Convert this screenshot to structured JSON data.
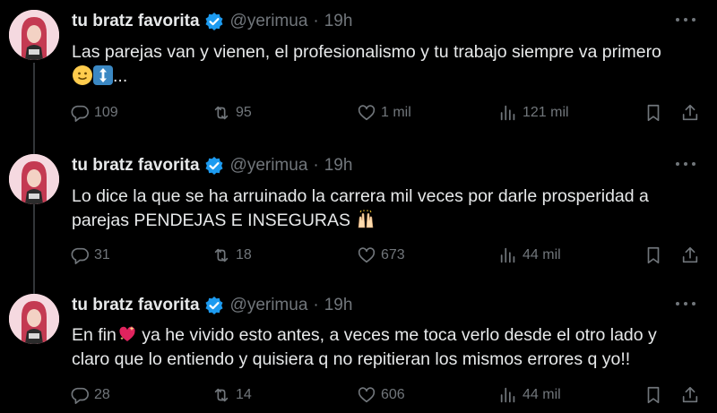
{
  "author": {
    "name": "tu bratz favorita",
    "handle": "@yerimua",
    "separator": "·",
    "time": "19h"
  },
  "icons": {
    "verified": "verified-badge-icon",
    "more": "more-options-icon",
    "reply": "reply-icon",
    "retweet": "retweet-icon",
    "like": "like-icon",
    "views": "views-icon",
    "bookmark": "bookmark-icon",
    "share": "share-icon"
  },
  "colors": {
    "background": "#000000",
    "verified": "#1d9bf0",
    "text": "#e7e9ea",
    "muted": "#71767b"
  },
  "tweets": [
    {
      "text_line1": "Las parejas van y vienen, el profesionalismo y tu trabajo siempre va primero",
      "text_line2_suffix": "...",
      "emojis": [
        "slightly-smiling-face-emoji",
        "up-down-arrow-emoji"
      ],
      "replies": "109",
      "retweets": "95",
      "likes": "1 mil",
      "views": "121 mil"
    },
    {
      "text_line1": "Lo dice la que se ha arruinado la carrera mil veces por darle prosperidad a",
      "text_line2": "parejas PENDEJAS E INSEGURAS",
      "emojis": [
        "raising-hands-emoji"
      ],
      "replies": "31",
      "retweets": "18",
      "likes": "673",
      "views": "44 mil"
    },
    {
      "text_line1_a": "En fin",
      "text_line1_b": " ya he vivido esto antes, a veces me toca verlo desde el otro lado y",
      "text_line2": "claro que lo entiendo y quisiera q no repitieran los mismos errores q yo!!",
      "emojis": [
        "sparkling-heart-emoji"
      ],
      "replies": "28",
      "retweets": "14",
      "likes": "606",
      "views": "44 mil"
    }
  ]
}
